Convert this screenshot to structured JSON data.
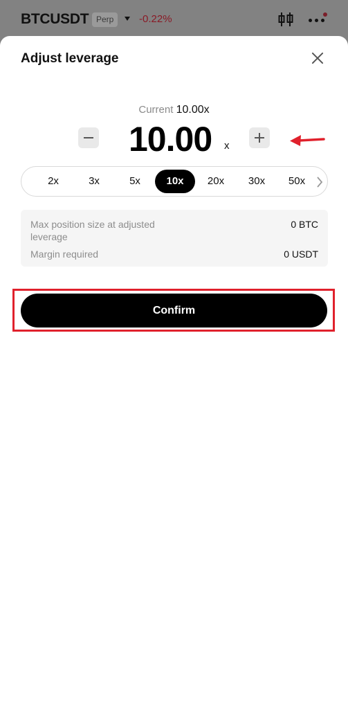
{
  "background": {
    "symbol": "BTCUSDT",
    "tag": "Perp",
    "change": "-0.22%",
    "chart_icon": "candlestick-icon",
    "more_icon": "more-dots-icon"
  },
  "sheet": {
    "title": "Adjust leverage",
    "close_icon": "close-icon",
    "current_label": "Current",
    "current_value": "10.00x",
    "leverage_value": "10.00",
    "leverage_unit": "x",
    "chips": [
      {
        "label": "2x",
        "active": false
      },
      {
        "label": "3x",
        "active": false
      },
      {
        "label": "5x",
        "active": false
      },
      {
        "label": "10x",
        "active": true
      },
      {
        "label": "20x",
        "active": false
      },
      {
        "label": "30x",
        "active": false
      },
      {
        "label": "50x",
        "active": false
      }
    ],
    "info": [
      {
        "label": "Max position size at adjusted leverage",
        "value": "0 BTC"
      },
      {
        "label": "Margin required",
        "value": "0 USDT"
      }
    ],
    "confirm_label": "Confirm"
  },
  "colors": {
    "annotation_red": "#e0212c",
    "accent_black": "#000000"
  }
}
